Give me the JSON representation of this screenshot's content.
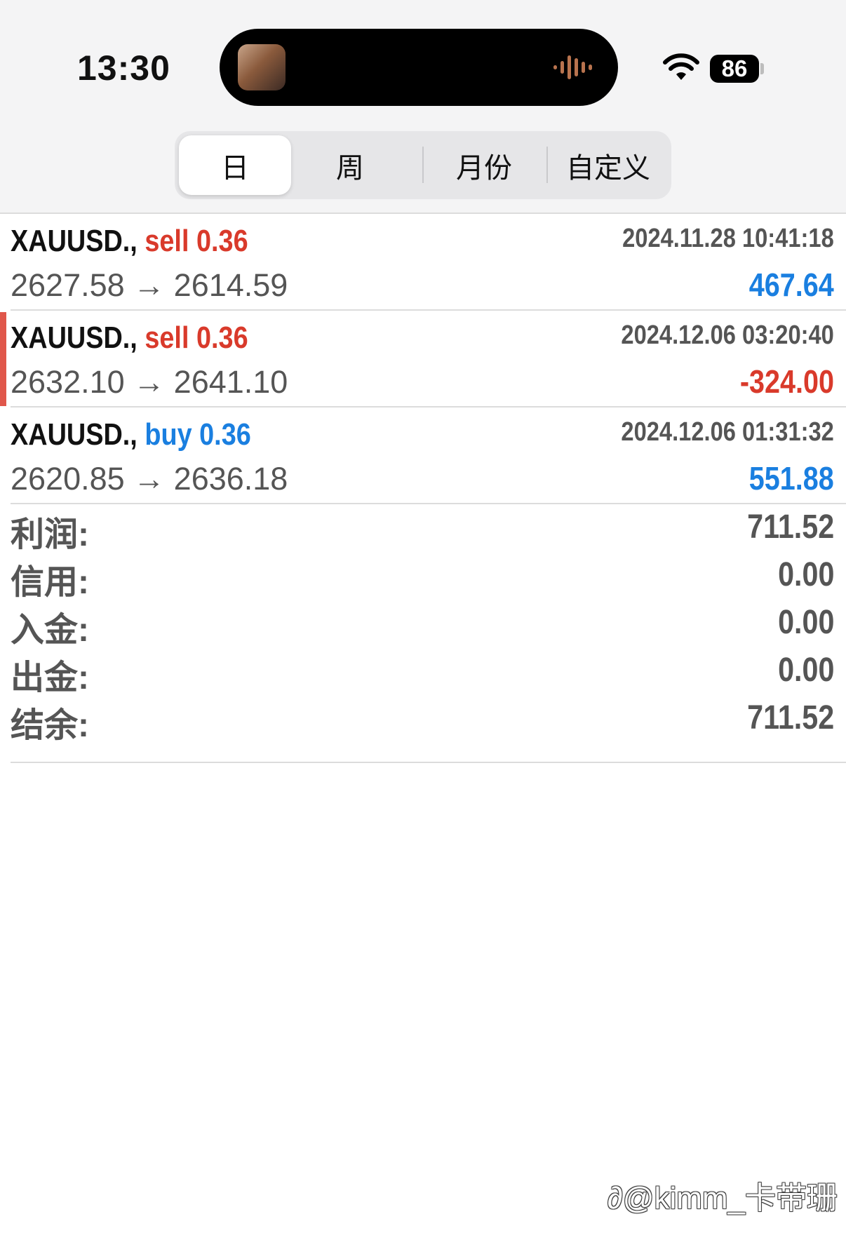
{
  "status_bar": {
    "time": "13:30",
    "battery": "86",
    "icons": [
      "album-art-icon",
      "audio-wave-icon",
      "wifi-icon",
      "battery-icon"
    ]
  },
  "segments": {
    "items": [
      {
        "label": "日",
        "active": true
      },
      {
        "label": "周",
        "active": false
      },
      {
        "label": "月份",
        "active": false
      },
      {
        "label": "自定义",
        "active": false
      }
    ]
  },
  "trades": [
    {
      "symbol": "XAUUSD.,",
      "side": "sell",
      "volume": "0.36",
      "time": "2024.11.28 10:41:18",
      "prices": "2627.58 → 2614.59",
      "profit": "467.64",
      "profit_sign": "positive"
    },
    {
      "symbol": "XAUUSD.,",
      "side": "sell",
      "volume": "0.36",
      "time": "2024.12.06 03:20:40",
      "prices": "2632.10 → 2641.10",
      "profit": "-324.00",
      "profit_sign": "negative",
      "selected": true
    },
    {
      "symbol": "XAUUSD.,",
      "side": "buy",
      "volume": "0.36",
      "time": "2024.12.06 01:31:32",
      "prices": "2620.85 → 2636.18",
      "profit": "551.88",
      "profit_sign": "positive"
    }
  ],
  "summary": [
    {
      "label": "利润:",
      "value": "711.52"
    },
    {
      "label": "信用:",
      "value": "0.00"
    },
    {
      "label": "入金:",
      "value": "0.00"
    },
    {
      "label": "出金:",
      "value": "0.00"
    },
    {
      "label": "结余:",
      "value": "711.52"
    }
  ],
  "watermark": "@kimm_卡带珊",
  "colors": {
    "sell": "#d93a2b",
    "buy": "#1a7fe0",
    "profit_positive": "#1a7fe0",
    "profit_negative": "#d93a2b",
    "selected_marker": "#e0574b"
  }
}
